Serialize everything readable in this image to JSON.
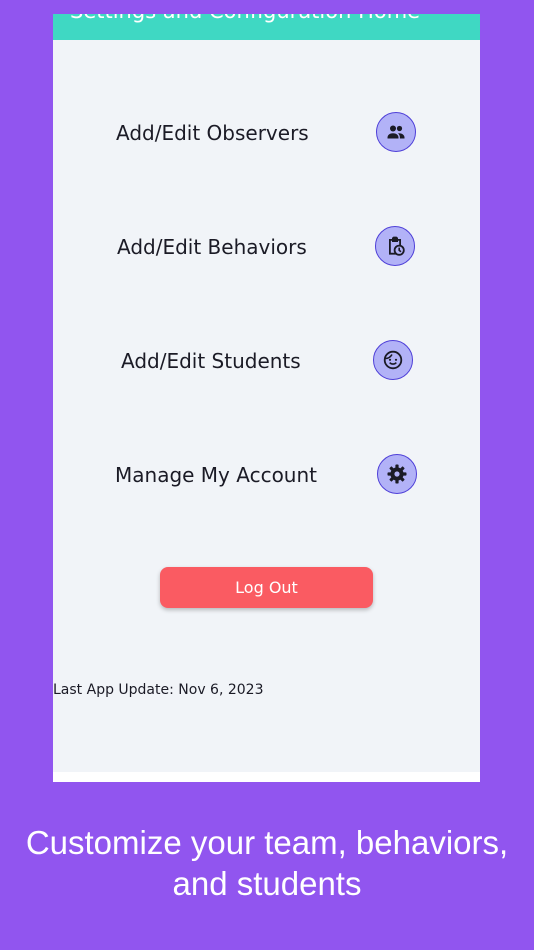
{
  "header": {
    "title": "Settings and Configuration Home"
  },
  "menu": [
    {
      "label": "Add/Edit Observers",
      "icon": "group-icon"
    },
    {
      "label": "Add/Edit Behaviors",
      "icon": "clipboard-clock-icon"
    },
    {
      "label": "Add/Edit Students",
      "icon": "child-face-icon"
    },
    {
      "label": "Manage My Account",
      "icon": "gear-icon"
    }
  ],
  "logout_label": "Log Out",
  "last_update": "Last App Update: Nov 6, 2023",
  "caption": {
    "line1": "Customize your team, behaviors,",
    "line2": "and students"
  },
  "colors": {
    "background": "#9155ef",
    "header": "#3fd8c3",
    "icon_fill": "#b2b2f7",
    "icon_border": "#4e3fd8",
    "logout": "#fa5b62"
  }
}
